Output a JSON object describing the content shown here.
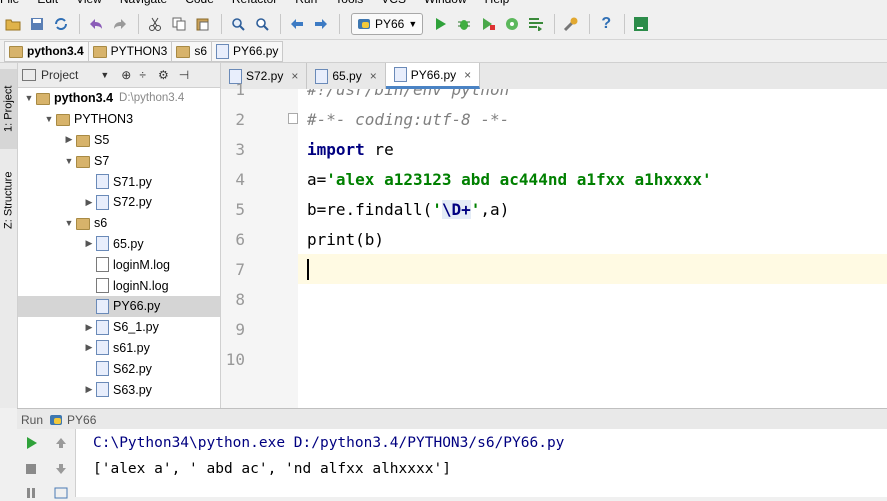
{
  "menu": [
    "File",
    "Edit",
    "View",
    "Navigate",
    "Code",
    "Refactor",
    "Run",
    "Tools",
    "VCS",
    "Window",
    "Help"
  ],
  "toolbar": {
    "run_config": "PY66"
  },
  "breadcrumb": [
    "python3.4",
    "PYTHON3",
    "s6",
    "PY66.py"
  ],
  "left_strip": {
    "project_tab": "1: Project",
    "structure_tab": "Z: Structure"
  },
  "project_panel": {
    "title": "Project",
    "tree": [
      {
        "label": "python3.4",
        "path": "D:\\python3.4",
        "type": "folder",
        "arrow": "▼"
      },
      {
        "label": "PYTHON3",
        "type": "folder",
        "arrow": "▼"
      },
      {
        "label": "S5",
        "type": "folder",
        "arrow": "▶"
      },
      {
        "label": "S7",
        "type": "folder",
        "arrow": "▼"
      },
      {
        "label": "S71.py",
        "type": "py",
        "arrow": ""
      },
      {
        "label": "S72.py",
        "type": "py",
        "arrow": "▶"
      },
      {
        "label": "s6",
        "type": "folder",
        "arrow": "▼"
      },
      {
        "label": "65.py",
        "type": "py",
        "arrow": "▶"
      },
      {
        "label": "loginM.log",
        "type": "log",
        "arrow": ""
      },
      {
        "label": "loginN.log",
        "type": "log",
        "arrow": ""
      },
      {
        "label": "PY66.py",
        "type": "py",
        "arrow": "",
        "selected": true
      },
      {
        "label": "S6_1.py",
        "type": "py",
        "arrow": "▶"
      },
      {
        "label": "s61.py",
        "type": "py",
        "arrow": "▶"
      },
      {
        "label": "S62.py",
        "type": "py",
        "arrow": ""
      },
      {
        "label": "S63.py",
        "type": "py",
        "arrow": "▶"
      }
    ]
  },
  "editor_tabs": [
    {
      "label": "S72.py",
      "close": "×"
    },
    {
      "label": "65.py",
      "close": "×"
    },
    {
      "label": "PY66.py",
      "close": "×",
      "active": true
    }
  ],
  "editor": {
    "line_numbers": [
      "1",
      "2",
      "3",
      "4",
      "5",
      "6",
      "7",
      "8",
      "9",
      "10"
    ],
    "line1": "#!/usr/bin/env python",
    "line2": "#-*- coding:utf-8 -*-",
    "line3_kw": "import",
    "line3_rest": " re",
    "line4_pre": "a=",
    "line4_str": "'alex a123123 abd ac444nd a1fxx a1hxxxx'",
    "line5_pre": "b=re.findall(",
    "line5_q1": "'",
    "line5_esc": "\\D+",
    "line5_q2": "'",
    "line5_post": ",a)",
    "line6": "print(b)"
  },
  "run_panel": {
    "label": "Run",
    "config": "PY66",
    "output": [
      "C:\\Python34\\python.exe D:/python3.4/PYTHON3/s6/PY66.py",
      "['alex a', ' abd ac', 'nd alfxx alhxxxx']"
    ]
  }
}
